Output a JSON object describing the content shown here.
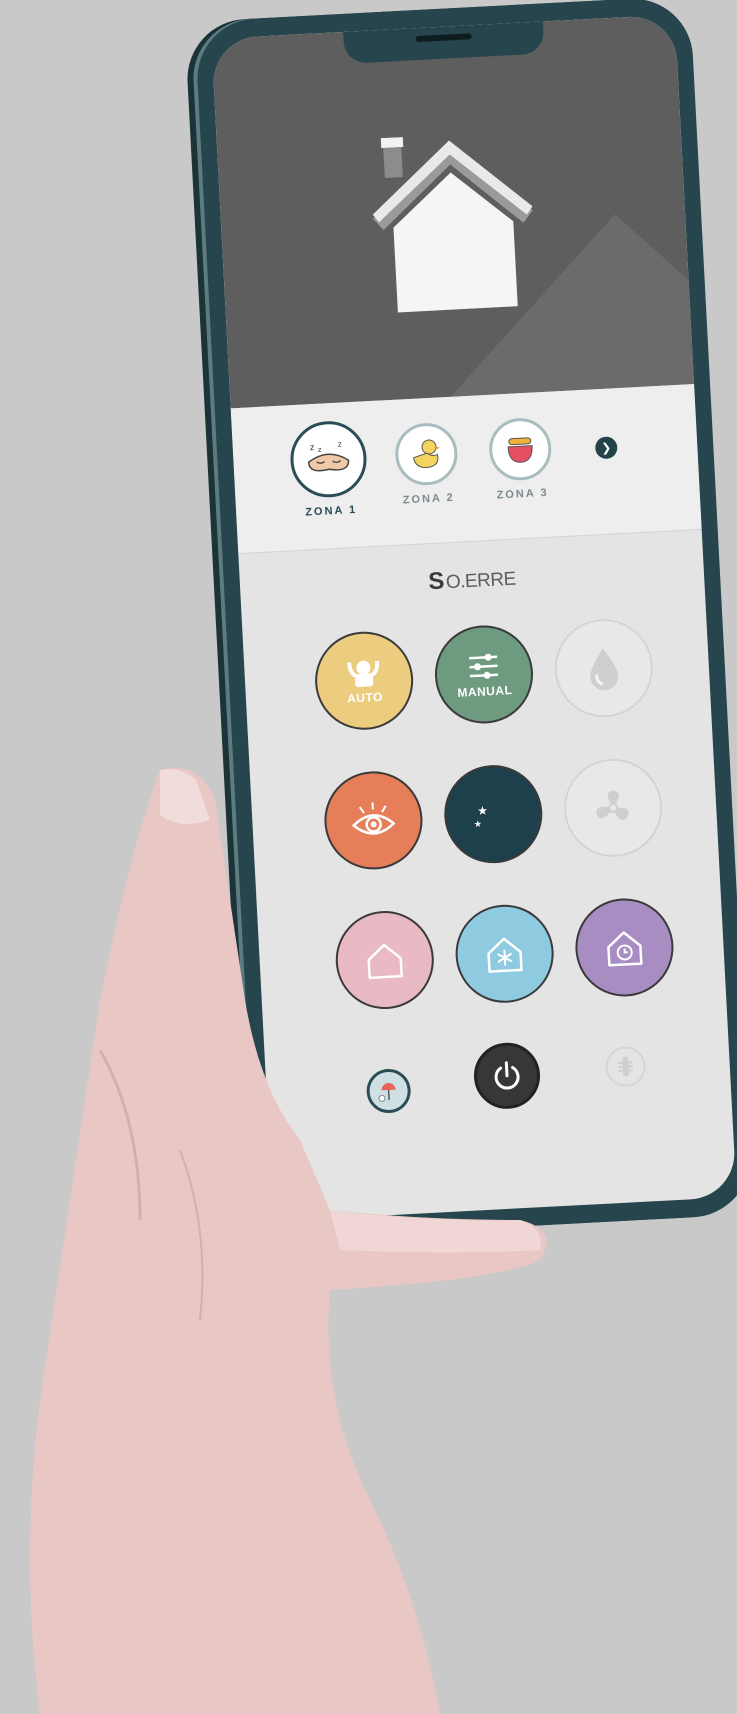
{
  "zones": [
    {
      "label": "ZONA 1",
      "icon": "sleeping-mask-icon",
      "active": true
    },
    {
      "label": "ZONA 2",
      "icon": "rubber-duck-icon",
      "active": false
    },
    {
      "label": "ZONA 3",
      "icon": "pot-icon",
      "active": false
    }
  ],
  "brand": {
    "mark": "S",
    "name": "O.ERRE"
  },
  "modes": {
    "auto_label": "AUTO",
    "manual_label": "MANUAL"
  },
  "colors": {
    "auto": "#eccc7e",
    "manual": "#6e9b80",
    "view": "#e57e59",
    "night": "#1e3f4c",
    "home": "#e9b9c4",
    "frost": "#8ecbe0",
    "schedule": "#a88dc2",
    "power": "#373737"
  },
  "icons": [
    "house-logo-icon",
    "droplet-icon",
    "fan-icon",
    "eye-icon",
    "moon-stars-icon",
    "home-icon",
    "snowflake-home-icon",
    "clock-home-icon",
    "weather-icon",
    "power-icon",
    "filter-icon"
  ]
}
